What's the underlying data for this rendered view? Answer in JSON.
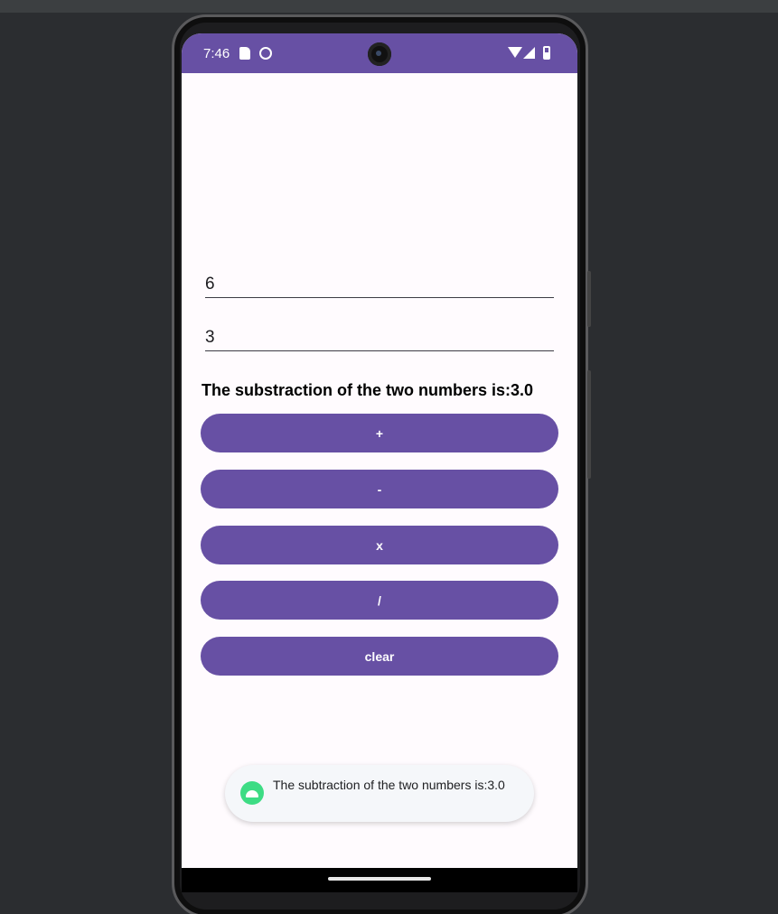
{
  "status_bar": {
    "time": "7:46",
    "icons": [
      "sd-card-icon",
      "sync-icon",
      "wifi-icon",
      "signal-icon",
      "battery-icon"
    ]
  },
  "fields": {
    "first_value": "6",
    "second_value": "3"
  },
  "result_text": "The substraction of the two numbers is:3.0",
  "buttons": {
    "add": "+",
    "subtract": "-",
    "multiply": "x",
    "divide": "/",
    "clear": "clear"
  },
  "toast": {
    "icon": "android-icon",
    "text": "The subtraction of the two numbers is:3.0"
  },
  "colors": {
    "primary": "#6750a4",
    "background": "#fffbfe",
    "toast_icon": "#3ddc84"
  }
}
